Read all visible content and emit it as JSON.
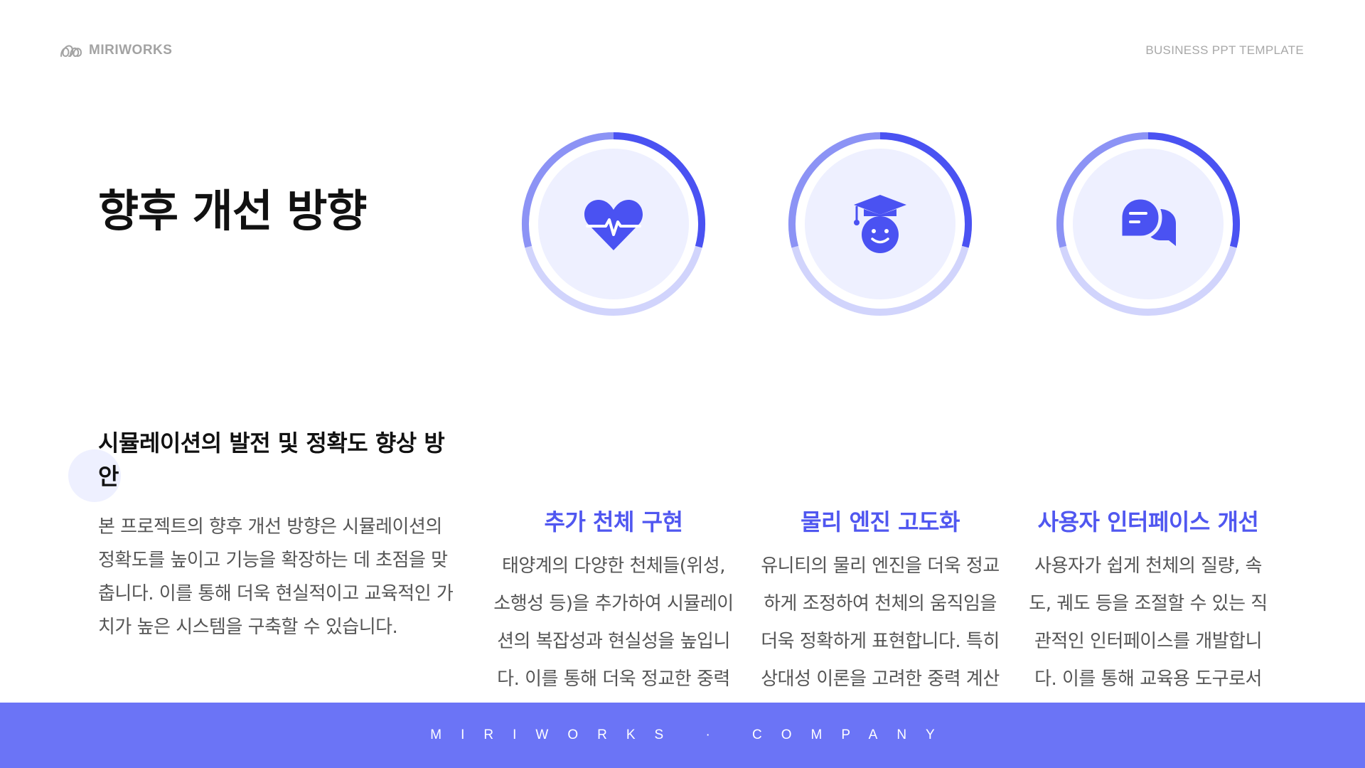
{
  "header": {
    "logo_text": "MIRIWORKS",
    "tagline": "BUSINESS PPT TEMPLATE"
  },
  "main": {
    "title": "향후 개선 방향",
    "subtitle": "시뮬레이션의 발전 및 정확도 향상 방안",
    "body": "본 프로젝트의 향후 개선 방향은 시뮬레이션의 정확도를 높이고 기능을 확장하는 데 초점을 맞춥니다. 이를 통해 더욱 현실적이고 교육적인 가치가 높은 시스템을 구축할 수 있습니다."
  },
  "features": [
    {
      "icon": "heartbeat-icon",
      "title": "추가 천체 구현",
      "body": "태양계의 다양한 천체들(위성, 소행성 등)을 추가하여 시뮬레이션의 복잡성과 현실성을 높입니다. 이를 통해 더욱 정교한 중력 상호작용을 구현할 수 있습니다."
    },
    {
      "icon": "graduate-icon",
      "title": "물리 엔진 고도화",
      "body": "유니티의 물리 엔진을 더욱 정교하게 조정하여 천체의 움직임을 더욱 정확하게 표현합니다. 특히 상대성 이론을 고려한 중력 계산 방식을 도입할 수 있습니다."
    },
    {
      "icon": "chat-bubbles-icon",
      "title": "사용자 인터페이스 개선",
      "body": "사용자가 쉽게 천체의 질량, 속도, 궤도 등을 조절할 수 있는 직관적인 인터페이스를 개발합니다. 이를 통해 교육용 도구로서의 가치를 높일 수 있습니다."
    }
  ],
  "footer": {
    "text": "MIRIWORKS · COMPANY"
  },
  "colors": {
    "accent": "#5057f0",
    "ring_light": "#d1d4fc",
    "ring_mid": "#8c93f5",
    "ring_dark": "#4a52f2",
    "icon_bg": "#eef0ff",
    "footer_bg": "#6b74f6"
  }
}
